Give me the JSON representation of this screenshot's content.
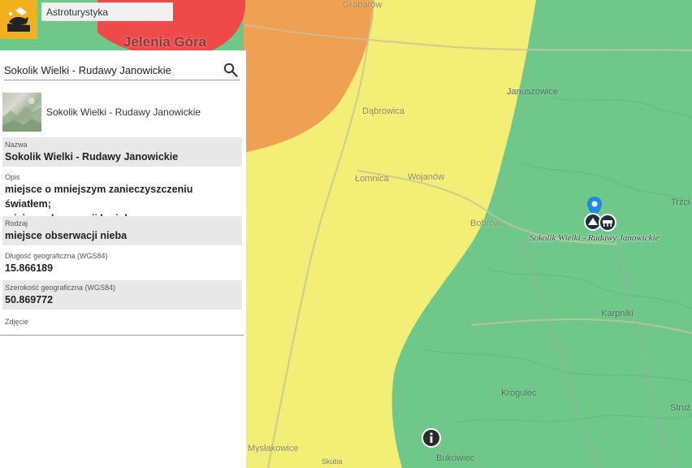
{
  "app": {
    "title": "Astroturystyka",
    "logo": "astro-logo-icon"
  },
  "search": {
    "value": "Sokolik Wielki - Rudawy Janowickie",
    "icon": "search-icon"
  },
  "result": {
    "title": "Sokolik Wielki - Rudawy Janowickie"
  },
  "attributes": [
    {
      "key": "Nazwa",
      "value": "Sokolik Wielki - Rudawy Janowickie"
    },
    {
      "key": "Opis",
      "value_line1": "miejsce o mniejszym zanieczyszczeniu światłem;",
      "value_line2": "miejsce obserwacji krajobrazu"
    },
    {
      "key": "Rodzaj",
      "value": "miejsce obserwacji nieba"
    },
    {
      "key": "Długość geograficzna (WGS84)",
      "value": "15.866189"
    },
    {
      "key": "Szerokość geograficzna (WGS84)",
      "value": "50.869772"
    },
    {
      "key": "Zdjęcie"
    }
  ],
  "map": {
    "places": {
      "jelenia_gora": "Jelenia Góra",
      "grabarow": "Grabarów",
      "dabrowica": "Dąbrowica",
      "lomnica": "Łomnica",
      "wojanow": "Wojanów",
      "bobrow": "Bobrów",
      "januszowice": "Januszowice",
      "trzci": "Trzci",
      "karpniki": "Karpniki",
      "krogulec": "Krogulec",
      "struz": "Struż",
      "bukowiec": "Bukowiec",
      "myslakowice": "Mysłakowice",
      "skuba": "Skuba"
    },
    "poi_label": "Sokolik Wielki - Rudawy Janowickie",
    "zone_colors": {
      "red": "#ee4a4a",
      "orange": "#f0a052",
      "yellow": "#f3ee76",
      "green": "#6fc88a"
    },
    "icons": [
      "location-pin-icon",
      "observation-point-icon",
      "telescope-icon",
      "info-icon"
    ]
  }
}
